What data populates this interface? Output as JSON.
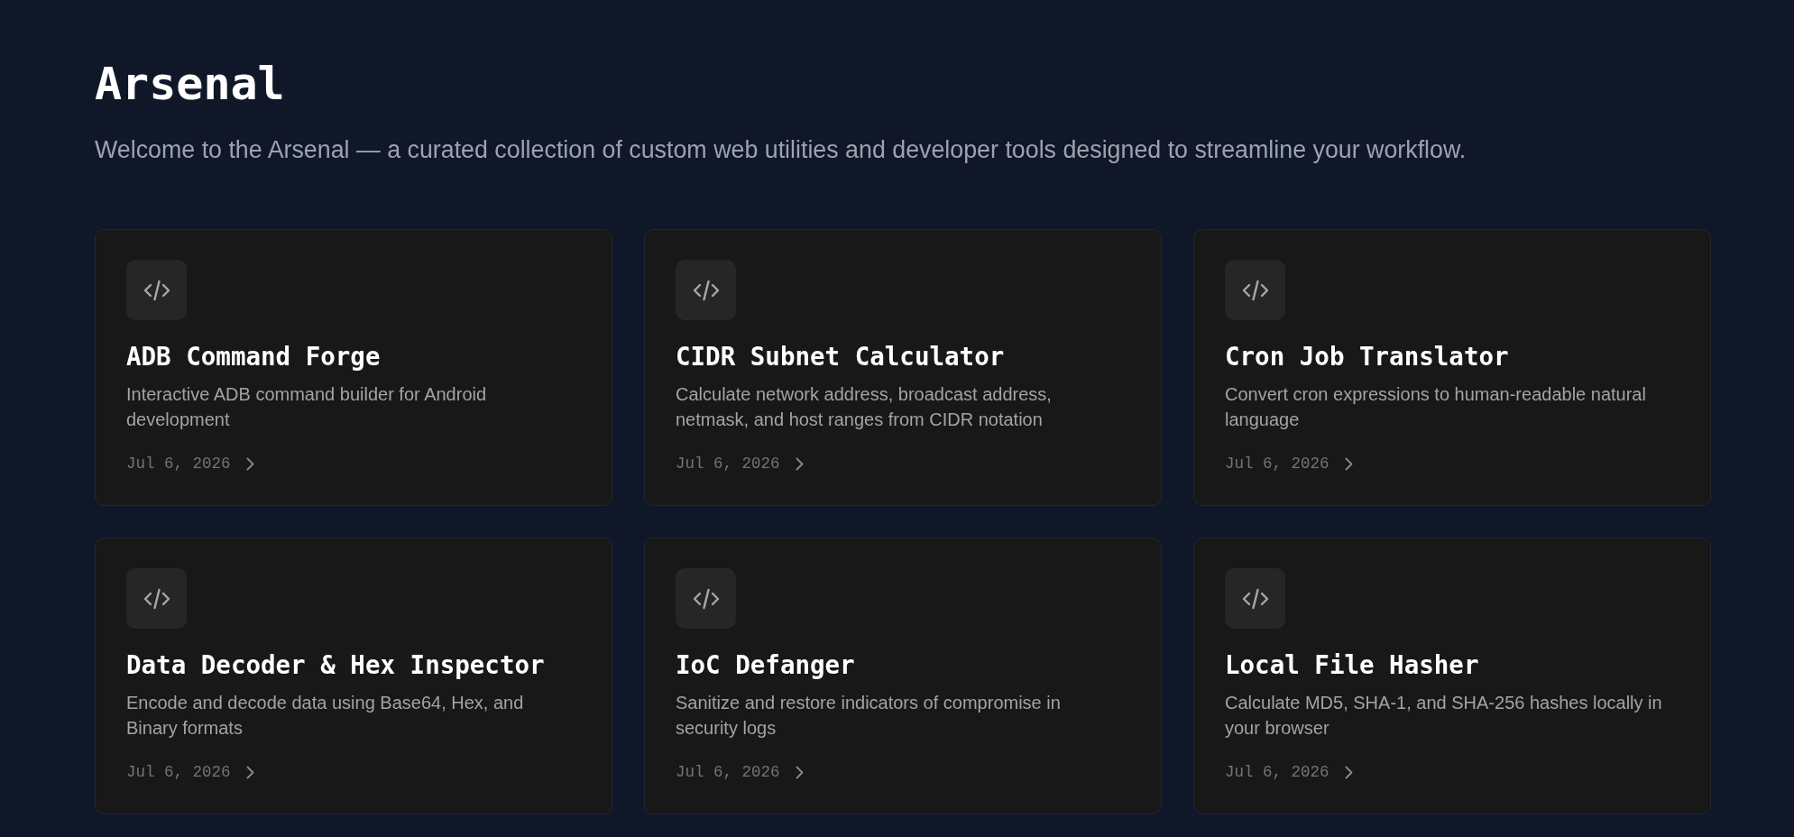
{
  "header": {
    "title": "Arsenal",
    "subtitle": "Welcome to the Arsenal — a curated collection of custom web utilities and developer tools designed to streamline your workflow."
  },
  "tools": [
    {
      "name": "ADB Command Forge",
      "description": "Interactive ADB command builder for Android development",
      "date": "Jul 6, 2026"
    },
    {
      "name": "CIDR Subnet Calculator",
      "description": "Calculate network address, broadcast address, netmask, and host ranges from CIDR notation",
      "date": "Jul 6, 2026"
    },
    {
      "name": "Cron Job Translator",
      "description": "Convert cron expressions to human-readable natural language",
      "date": "Jul 6, 2026"
    },
    {
      "name": "Data Decoder & Hex Inspector",
      "description": "Encode and decode data using Base64, Hex, and Binary formats",
      "date": "Jul 6, 2026"
    },
    {
      "name": "IoC Defanger",
      "description": "Sanitize and restore indicators of compromise in security logs",
      "date": "Jul 6, 2026"
    },
    {
      "name": "Local File Hasher",
      "description": "Calculate MD5, SHA-1, and SHA-256 hashes locally in your browser",
      "date": "Jul 6, 2026"
    }
  ]
}
